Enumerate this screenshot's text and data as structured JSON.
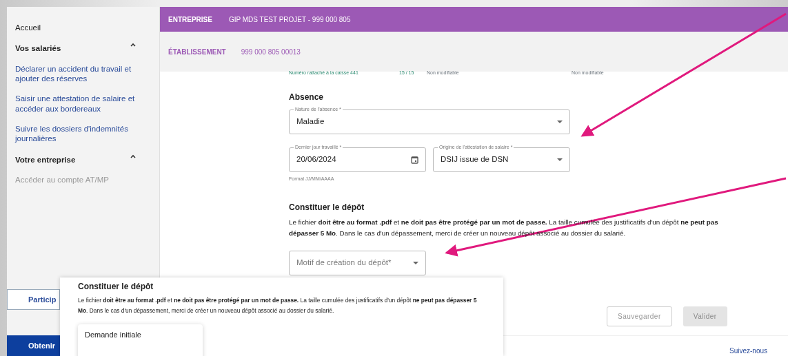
{
  "sidebar": {
    "items": [
      {
        "kind": "link",
        "label": "Accueil"
      },
      {
        "kind": "section",
        "label": "Vos salariés",
        "expanded": true
      },
      {
        "kind": "sublink",
        "label": "Déclarer un accident du travail et ajouter des réserves",
        "disabled": false
      },
      {
        "kind": "sublink",
        "label": "Saisir une attestation de salaire et accéder aux bordereaux",
        "disabled": false
      },
      {
        "kind": "sublink",
        "label": "Suivre les dossiers d'indemnités journalières",
        "disabled": false
      },
      {
        "kind": "section",
        "label": "Votre entreprise",
        "expanded": true
      },
      {
        "kind": "sublink",
        "label": "Accéder au compte AT/MP",
        "disabled": true
      }
    ],
    "buttons": [
      {
        "label": "Particip"
      },
      {
        "label": "Obtenir"
      }
    ]
  },
  "header": {
    "company_label": "ENTREPRISE",
    "company": "GIP MDS TEST PROJET - 999 000 805",
    "establishment_label": "ÉTABLISSEMENT",
    "establishment": "999 000 805 00013"
  },
  "cut_row": {
    "label": "Numéro rattaché à la caisse 441",
    "count": "15 / 15",
    "status_1": "Non modifiable",
    "status_2": "Non modifiable"
  },
  "absence": {
    "title": "Absence",
    "fields": [
      {
        "kind": "select",
        "label": "Nature de l'absence *",
        "value": "Maladie"
      },
      {
        "kind": "date",
        "label": "Dernier jour travaillé *",
        "value": "20/06/2024",
        "hint": "Format JJ/MM/AAAA"
      },
      {
        "kind": "select",
        "label": "Origine de l'attestation de salaire *",
        "value": "DSIJ issue de DSN"
      }
    ]
  },
  "depot": {
    "title": "Constituer le dépôt",
    "text": "Le fichier **doit être au format .pdf** et **ne doit pas être protégé par un mot de passe.** La taille cumulée des justificatifs d'un dépôt **ne peut pas dépasser 5 Mo**. Dans le cas d'un dépassement, merci de créer un nouveau dépôt associé au dossier du salarié.",
    "select_placeholder": "Motif de création du dépôt*"
  },
  "actions": [
    {
      "label": "Sauvegarder",
      "disabled": true
    },
    {
      "label": "Valider",
      "disabled": true
    }
  ],
  "footer": {
    "link": "Suivez-nous"
  },
  "inset": {
    "title": "Constituer le dépôt",
    "text": "Le fichier **doit être au format .pdf** et **ne doit pas être protégé par un mot de passe.** La taille cumulée des justificatifs d'un dépôt **ne peut pas dépasser 5 Mo**. Dans le cas d'un dépassement, merci de créer un nouveau dépôt associé au dossier du salarié.",
    "menu": [
      {
        "label": "Demande initiale",
        "selected": false
      }
    ]
  }
}
